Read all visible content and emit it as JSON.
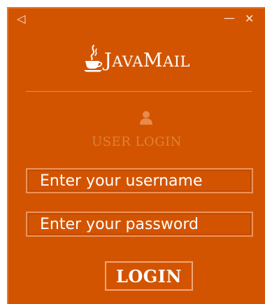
{
  "window": {
    "back_glyph": "◁",
    "minimize_glyph": "—",
    "close_glyph": "✕"
  },
  "logo": {
    "text_first_cap": "J",
    "text_first_rest": "AVA",
    "text_second_cap": "M",
    "text_second_rest": "AIL",
    "icon": "java-cup-icon"
  },
  "login_section": {
    "icon": "user-icon",
    "title": "USER LOGIN"
  },
  "fields": {
    "username_placeholder": "Enter your username",
    "password_placeholder": "Enter your password"
  },
  "login_button": {
    "label": "LOGIN"
  },
  "colors": {
    "background": "#d35400",
    "accent_light": "#ee9256",
    "title_text": "#e0813b",
    "text": "#ffffff"
  }
}
